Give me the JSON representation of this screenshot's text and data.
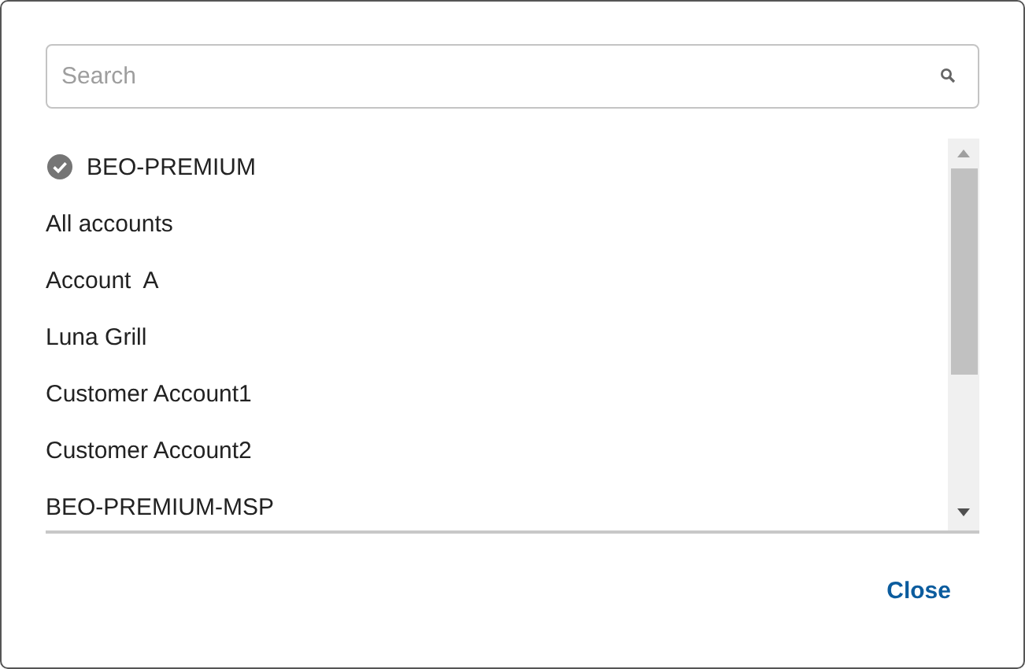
{
  "search": {
    "placeholder": "Search"
  },
  "accounts": [
    {
      "label": "BEO-PREMIUM",
      "selected": true
    },
    {
      "label": "All accounts",
      "selected": false
    },
    {
      "label": "Account  A",
      "selected": false
    },
    {
      "label": "Luna Grill",
      "selected": false
    },
    {
      "label": "Customer Account1",
      "selected": false
    },
    {
      "label": "Customer Account2",
      "selected": false
    },
    {
      "label": "BEO-PREMIUM-MSP",
      "selected": false
    }
  ],
  "buttons": [
    {
      "label": "Close"
    }
  ]
}
